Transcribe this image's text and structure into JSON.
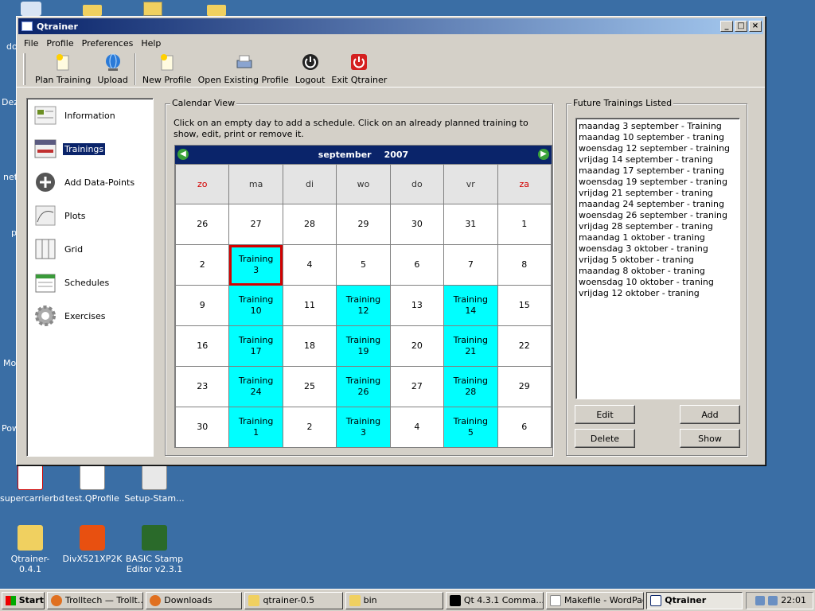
{
  "desktop": {
    "icons": [
      {
        "label": "supercarrierbd",
        "icon": "pdf-icon"
      },
      {
        "label": "test.QProfile",
        "icon": "document-icon"
      },
      {
        "label": "Setup-Stam...",
        "icon": "setup-icon"
      },
      {
        "label": "Qtrainer-0.4.1",
        "icon": "folder-icon"
      },
      {
        "label": "DivX521XP2K",
        "icon": "divx-icon"
      },
      {
        "label": "BASIC Stamp Editor v2.3.1",
        "icon": "stamp-editor-icon"
      }
    ],
    "fragments": [
      "do",
      "Dez",
      "net",
      "p",
      "Mo",
      "Pow"
    ]
  },
  "window": {
    "title": "Qtrainer",
    "controls": [
      "_",
      "□",
      "×"
    ]
  },
  "menu": [
    "File",
    "Profile",
    "Preferences",
    "Help"
  ],
  "toolbar": {
    "buttons": [
      {
        "label": "Plan Training",
        "icon": "plan-training-icon"
      },
      {
        "label": "Upload",
        "icon": "globe-icon"
      },
      {
        "label": "New Profile",
        "icon": "new-profile-icon"
      },
      {
        "label": "Open Existing Profile",
        "icon": "printer-icon"
      },
      {
        "label": "Logout",
        "icon": "logout-icon"
      },
      {
        "label": "Exit Qtrainer",
        "icon": "exit-icon"
      }
    ]
  },
  "nav": {
    "items": [
      {
        "label": "Information",
        "icon": "information-icon"
      },
      {
        "label": "Trainings",
        "icon": "trainings-icon",
        "selected": true
      },
      {
        "label": "Add Data-Points",
        "icon": "add-icon"
      },
      {
        "label": "Plots",
        "icon": "plot-icon"
      },
      {
        "label": "Grid",
        "icon": "grid-icon"
      },
      {
        "label": "Schedules",
        "icon": "schedules-icon"
      },
      {
        "label": "Exercises",
        "icon": "gear-icon"
      }
    ]
  },
  "calendar": {
    "group_title": "Calendar View",
    "instructions": "Click on an empty day to add a schedule. Click on an already planned training to show, edit, print or remove it.",
    "month": "september",
    "year": "2007",
    "prev_icon": "arrow-left-icon",
    "next_icon": "arrow-right-icon",
    "weekdays": [
      "zo",
      "ma",
      "di",
      "wo",
      "do",
      "vr",
      "za"
    ],
    "weekend_color": "#d40000",
    "training_color": "#00ffff",
    "weeks": [
      [
        {
          "day": "26"
        },
        {
          "day": "27"
        },
        {
          "day": "28"
        },
        {
          "day": "29"
        },
        {
          "day": "30"
        },
        {
          "day": "31"
        },
        {
          "day": "1"
        }
      ],
      [
        {
          "day": "2"
        },
        {
          "day": "3",
          "training": "Training",
          "selected": true
        },
        {
          "day": "4"
        },
        {
          "day": "5"
        },
        {
          "day": "6"
        },
        {
          "day": "7"
        },
        {
          "day": "8"
        }
      ],
      [
        {
          "day": "9"
        },
        {
          "day": "10",
          "training": "Training"
        },
        {
          "day": "11"
        },
        {
          "day": "12",
          "training": "Training"
        },
        {
          "day": "13"
        },
        {
          "day": "14",
          "training": "Training"
        },
        {
          "day": "15"
        }
      ],
      [
        {
          "day": "16"
        },
        {
          "day": "17",
          "training": "Training"
        },
        {
          "day": "18"
        },
        {
          "day": "19",
          "training": "Training"
        },
        {
          "day": "20"
        },
        {
          "day": "21",
          "training": "Training"
        },
        {
          "day": "22"
        }
      ],
      [
        {
          "day": "23"
        },
        {
          "day": "24",
          "training": "Training"
        },
        {
          "day": "25"
        },
        {
          "day": "26",
          "training": "Training"
        },
        {
          "day": "27"
        },
        {
          "day": "28",
          "training": "Training"
        },
        {
          "day": "29"
        }
      ],
      [
        {
          "day": "30"
        },
        {
          "day": "1",
          "training": "Training"
        },
        {
          "day": "2"
        },
        {
          "day": "3",
          "training": "Training"
        },
        {
          "day": "4"
        },
        {
          "day": "5",
          "training": "Training"
        },
        {
          "day": "6"
        }
      ]
    ]
  },
  "future": {
    "group_title": "Future Trainings Listed",
    "items": [
      "maandag 3 september - Training",
      "maandag 10 september - traning",
      "woensdag 12 september - training",
      "vrijdag 14 september - traning",
      "maandag 17 september - traning",
      "woensdag 19 september - traning",
      "vrijdag 21 september - traning",
      "maandag 24 september - traning",
      "woensdag 26 september - traning",
      "vrijdag 28 september - traning",
      "maandag 1 oktober - traning",
      "woensdag 3 oktober - traning",
      "vrijdag 5 oktober - traning",
      "maandag 8 oktober - traning",
      "woensdag 10 oktober - traning",
      "vrijdag 12 oktober - traning"
    ],
    "buttons": {
      "edit": "Edit",
      "add": "Add",
      "delete": "Delete",
      "show": "Show"
    }
  },
  "taskbar": {
    "start": "Start",
    "tasks": [
      {
        "label": "Trolltech — Trollt...",
        "icon": "firefox-icon"
      },
      {
        "label": "Downloads",
        "icon": "firefox-icon"
      },
      {
        "label": "qtrainer-0.5",
        "icon": "folder-icon"
      },
      {
        "label": "bin",
        "icon": "folder-icon"
      },
      {
        "label": "Qt 4.3.1 Comma...",
        "icon": "console-icon"
      },
      {
        "label": "Makefile - WordPad",
        "icon": "wordpad-icon"
      },
      {
        "label": "Qtrainer",
        "icon": "window-icon",
        "active": true
      }
    ],
    "clock": "22:01"
  }
}
